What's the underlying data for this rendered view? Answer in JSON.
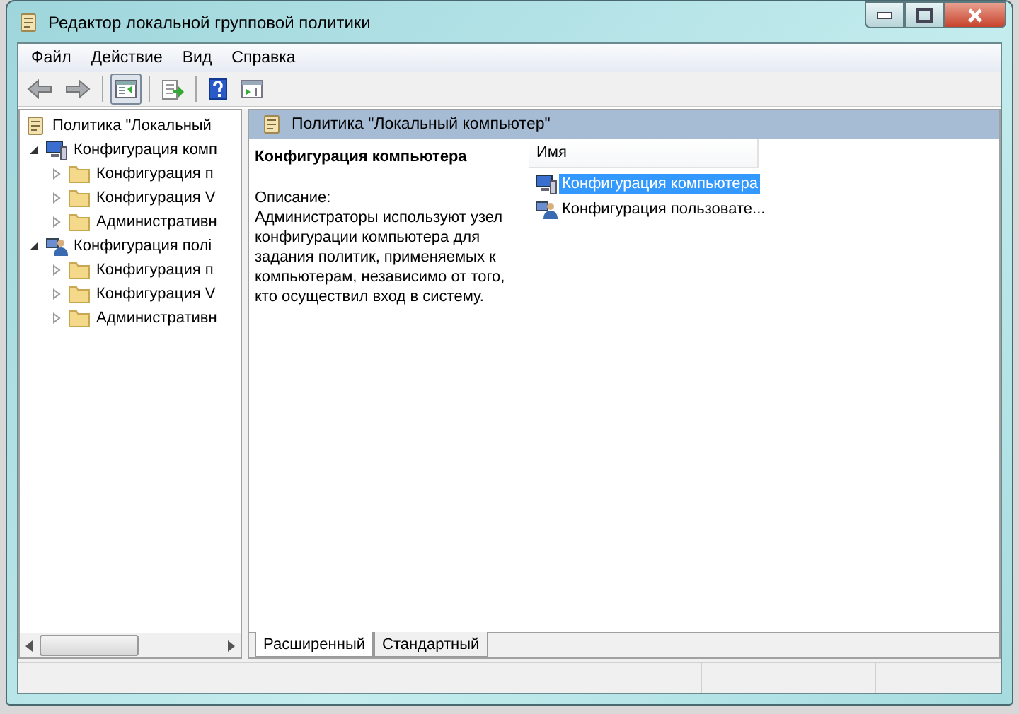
{
  "window": {
    "title": "Редактор локальной групповой политики"
  },
  "menu": [
    "Файл",
    "Действие",
    "Вид",
    "Справка"
  ],
  "toolbar": [
    {
      "kind": "back",
      "disabled": true
    },
    {
      "kind": "forward",
      "disabled": true
    },
    {
      "kind": "sep"
    },
    {
      "kind": "pane",
      "selected": true
    },
    {
      "kind": "sep"
    },
    {
      "kind": "export"
    },
    {
      "kind": "sep"
    },
    {
      "kind": "help"
    },
    {
      "kind": "view"
    }
  ],
  "tree": {
    "label": "Политика \"Локальный",
    "kind": "policy",
    "children": [
      {
        "label": "Конфигурация комп",
        "kind": "computer",
        "expanded": true,
        "children": [
          {
            "label": "Конфигурация п",
            "kind": "folder",
            "expanded": false
          },
          {
            "label": "Конфигурация V",
            "kind": "folder",
            "expanded": false
          },
          {
            "label": "Административн",
            "kind": "folder",
            "expanded": false
          }
        ]
      },
      {
        "label": "Конфигурация полі",
        "kind": "user",
        "expanded": true,
        "children": [
          {
            "label": "Конфигурация п",
            "kind": "folder",
            "expanded": false
          },
          {
            "label": "Конфигурация V",
            "kind": "folder",
            "expanded": false
          },
          {
            "label": "Административн",
            "kind": "folder",
            "expanded": false
          }
        ]
      }
    ]
  },
  "details": {
    "header": "Политика \"Локальный компьютер\"",
    "title": "Конфигурация компьютера",
    "description_label": "Описание:",
    "description": "Администраторы используют узел конфигурации компьютера для задания политик, применяемых к компьютерам, независимо от того, кто осуществил вход в систему.",
    "column": "Имя",
    "items": [
      {
        "label": "Конфигурация компьютера",
        "kind": "computer",
        "selected": true
      },
      {
        "label": "Конфигурация пользовате...",
        "kind": "user",
        "selected": false
      }
    ]
  },
  "tabs": [
    {
      "label": "Расширенный",
      "selected": true
    },
    {
      "label": "Стандартный",
      "selected": false
    }
  ]
}
